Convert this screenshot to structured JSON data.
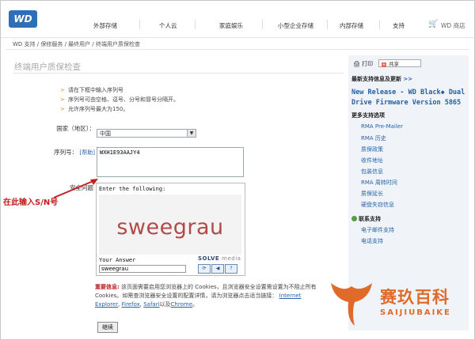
{
  "nav": {
    "logo": "WD",
    "items": [
      "外部存储",
      "个人云",
      "家庭娱乐",
      "小型企业存储",
      "内部存储",
      "支持"
    ],
    "store": "WD 商店"
  },
  "breadcrumb": "WD 支持 / 保修服务 / 最终用户 / 终端用户质保检查",
  "main": {
    "title": "终端用户质保检查",
    "instructions": [
      "请在下框中输入序列号",
      "序列号可由空格、逗号、分号和冒号分隔开。",
      "允许序列号最大为150。"
    ],
    "country_label": "国家（地区）：",
    "country_value": "中国",
    "serial_label": "序列号：",
    "serial_help": "[帮助]",
    "serial_value": "WXH1E93AAJY4",
    "security_label": "安全问题",
    "captcha": {
      "instruction": "Enter the following:",
      "word": "sweegrau",
      "answer_label": "Your Answer",
      "answer_value": "sweegrau",
      "brand": "SOLVE",
      "brand_suffix": "media",
      "btn_refresh": "⟳",
      "btn_audio": "◀",
      "btn_help": "?"
    },
    "annotation": "在此输入S/N号",
    "notice": {
      "important": "重要信息:",
      "text": "该页面需要启用您浏览器上的 Cookies，且浏览器安全设置需设置为不阻止所有 Cookies。如需查浏览器安全设置的配置详情，请为浏览器点击适当链接：",
      "link_ie": "Internet Explorer",
      "link_firefox": "Firefox",
      "link_safari": "Safari",
      "and": "以及",
      "link_chrome": "Chrome"
    },
    "continue_button": "继续"
  },
  "sidebar": {
    "print": "打印",
    "share": "共享",
    "latest_heading": "最新支持信息及更新",
    "more": ">>",
    "release": "New Release - WD Black◆ Dual Drive Firmware Version 5865",
    "options_heading": "更多支持选项",
    "options": [
      "RMA Pre-Mailer",
      "RMA 历史",
      "质保政策",
      "收件地址",
      "包装信息",
      "RMA 周转时间",
      "质保延长",
      "硬盘失窃信息"
    ],
    "contact_heading": "联系支持",
    "contact_items": [
      "电子邮件支持",
      "电话支持"
    ]
  },
  "watermark": {
    "cn": "赛玖百科",
    "en": "SAIJIUBAIKE"
  }
}
